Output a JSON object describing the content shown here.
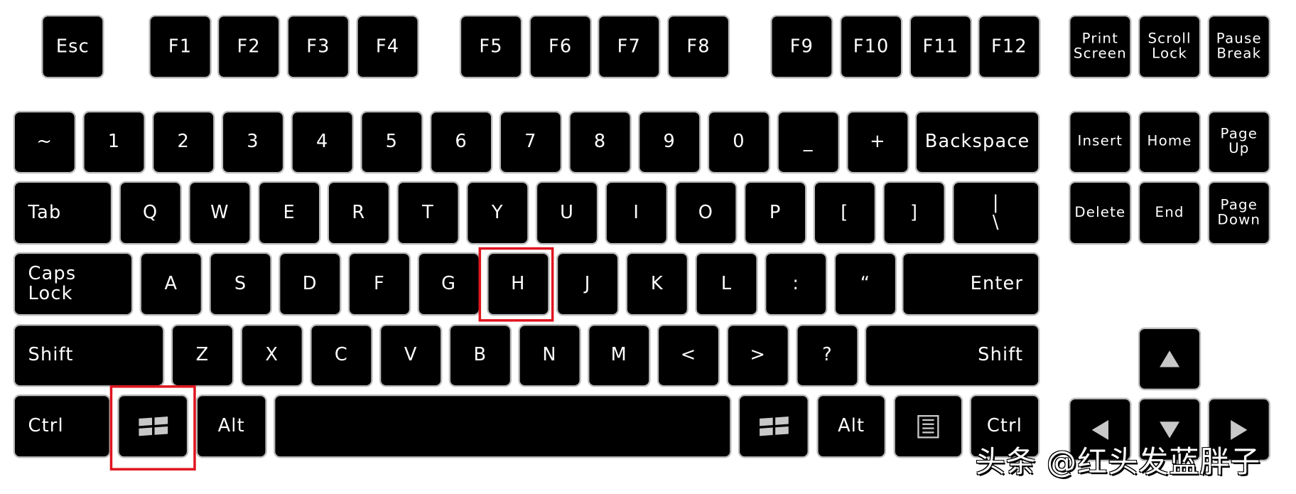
{
  "keyboard": {
    "function_row": [
      "Esc",
      "F1",
      "F2",
      "F3",
      "F4",
      "F5",
      "F6",
      "F7",
      "F8",
      "F9",
      "F10",
      "F11",
      "F12"
    ],
    "system_keys": [
      "Print\nScreen",
      "Scroll\nLock",
      "Pause\nBreak"
    ],
    "number_row": [
      "~",
      "1",
      "2",
      "3",
      "4",
      "5",
      "6",
      "7",
      "8",
      "9",
      "0",
      "_",
      "+",
      "Backspace"
    ],
    "nav_top": [
      "Insert",
      "Home",
      "Page\nUp"
    ],
    "tab_row": [
      "Tab",
      "Q",
      "W",
      "E",
      "R",
      "T",
      "Y",
      "U",
      "I",
      "O",
      "P",
      "[",
      "]",
      "|\n\\"
    ],
    "nav_bottom": [
      "Delete",
      "End",
      "Page\nDown"
    ],
    "caps_row": [
      "Caps\nLock",
      "A",
      "S",
      "D",
      "F",
      "G",
      "H",
      "J",
      "K",
      "L",
      ":",
      "“",
      "Enter"
    ],
    "shift_row": [
      "Shift",
      "Z",
      "X",
      "C",
      "V",
      "B",
      "N",
      "M",
      "<",
      ">",
      "?",
      "Shift"
    ],
    "bottom_row": [
      "Ctrl",
      "windows-icon",
      "Alt",
      "",
      "windows-icon",
      "Alt",
      "menu-icon",
      "Ctrl"
    ],
    "arrows": [
      "arrow-up-icon",
      "arrow-left-icon",
      "arrow-down-icon",
      "arrow-right-icon"
    ],
    "highlighted_keys": [
      "H",
      "Windows (left)"
    ],
    "highlight_color": "#e0141e",
    "key_color": "#000000",
    "key_border_color": "#bdbdbd"
  },
  "watermark": "头条 @红头发蓝胖子"
}
